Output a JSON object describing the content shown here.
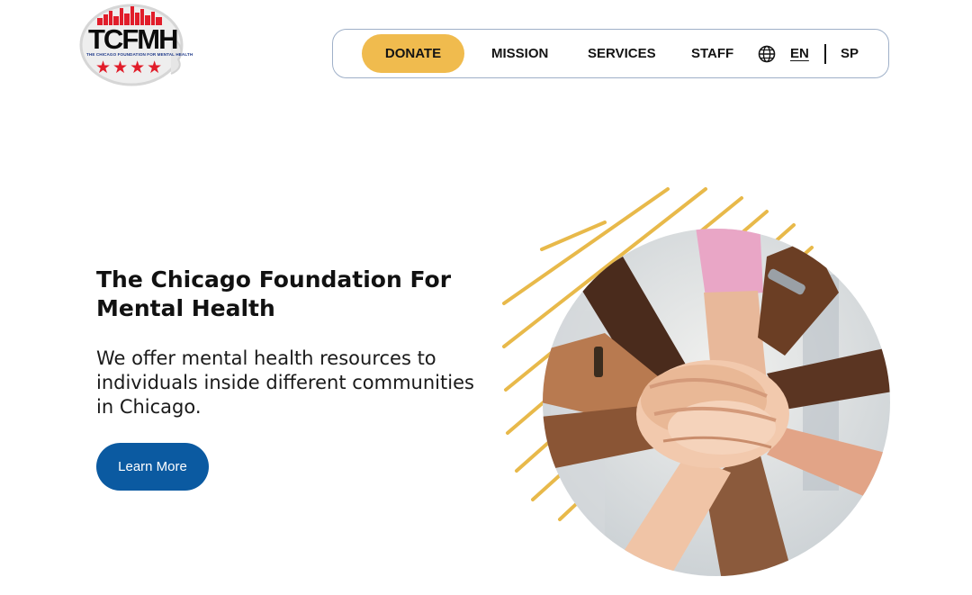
{
  "logo": {
    "acronym": "TCFMH",
    "tagline": "THE CHICAGO FOUNDATION FOR MENTAL HEALTH",
    "stars": "★★★★"
  },
  "nav": {
    "donate_label": "DONATE",
    "items": [
      {
        "label": "MISSION"
      },
      {
        "label": "SERVICES"
      },
      {
        "label": "STAFF"
      }
    ],
    "language": {
      "icon": "globe-icon",
      "options": [
        "EN",
        "SP"
      ],
      "selected": "EN"
    }
  },
  "hero": {
    "title": "The Chicago Foundation For Mental Health",
    "subtitle": "We offer mental health resources to individuals inside different communities in Chicago.",
    "cta_label": "Learn More",
    "image": "hands-stacked-together-photo"
  },
  "colors": {
    "accent_yellow": "#f0bb4e",
    "primary_blue": "#0b5aa1",
    "nav_border": "#9fb0c8",
    "logo_red": "#e11d2a",
    "stripe_yellow": "#e8b94a"
  }
}
